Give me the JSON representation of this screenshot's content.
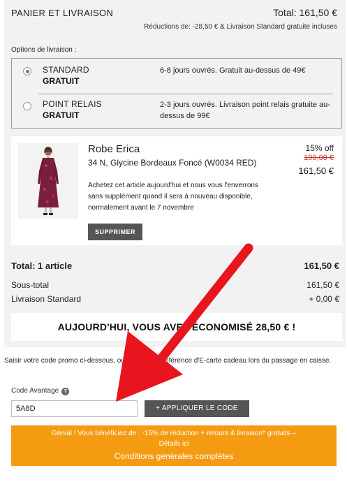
{
  "header": {
    "title": "PANIER ET LIVRAISON",
    "total": "Total: 161,50 €",
    "subtitle": "Réductions de: -28,50 € & Livraison Standard gratuite incluses"
  },
  "delivery": {
    "title": "Options de livraison :",
    "options": [
      {
        "name": "STANDARD",
        "price": "GRATUIT",
        "description": "6-8 jours ouvrés. Gratuit au-dessus de 49€",
        "selected": true
      },
      {
        "name": "POINT RELAIS",
        "price": "GRATUIT",
        "description": "2-3 jours ouvrés. Livraison point relais gratuite au-dessus de 99€",
        "selected": false
      }
    ]
  },
  "item": {
    "name": "Robe Erica",
    "variant": "34 N, Glycine Bordeaux Foncé (W0034 RED)",
    "discount": "15% off",
    "old_price": "190,00 €",
    "price": "161,50 €",
    "note": "Achetez cet article aujourd'hui et nous vous l'enverrons sans supplément quand il sera à nouveau disponible, normalement avant le 7 novembre",
    "delete_label": "SUPPRIMER"
  },
  "summary": {
    "total_label": "Total: 1 article",
    "total_value": "161,50 €",
    "subtotal_label": "Sous-total",
    "subtotal_value": "161,50 €",
    "shipping_label": "Livraison Standard",
    "shipping_value": "+ 0,00 €"
  },
  "savings": "AUJOURD'HUI, VOUS AVEZ ÉCONOMISÉ 28,50 € !",
  "promo": {
    "info": "Saisir votre code promo ci-dessous, ou saisir votre référence d'E-carte cadeau lors du passage en caisse.",
    "label": "Code Avantage",
    "help": "?",
    "code_value": "5A8D",
    "apply_label": "+ APPLIQUER LE CODE"
  },
  "banner": {
    "line1": "Génial ! Vous bénéficiez de : -15% de réduction + retours & livraison* gratuits –",
    "line2": "Détails ici",
    "line3": "Conditions générales complètes"
  },
  "colors": {
    "panel_bg": "#f2f2f2",
    "button_bg": "#555555",
    "banner_bg": "#f49b12",
    "old_price": "#d0302f",
    "arrow": "#e8141e"
  }
}
